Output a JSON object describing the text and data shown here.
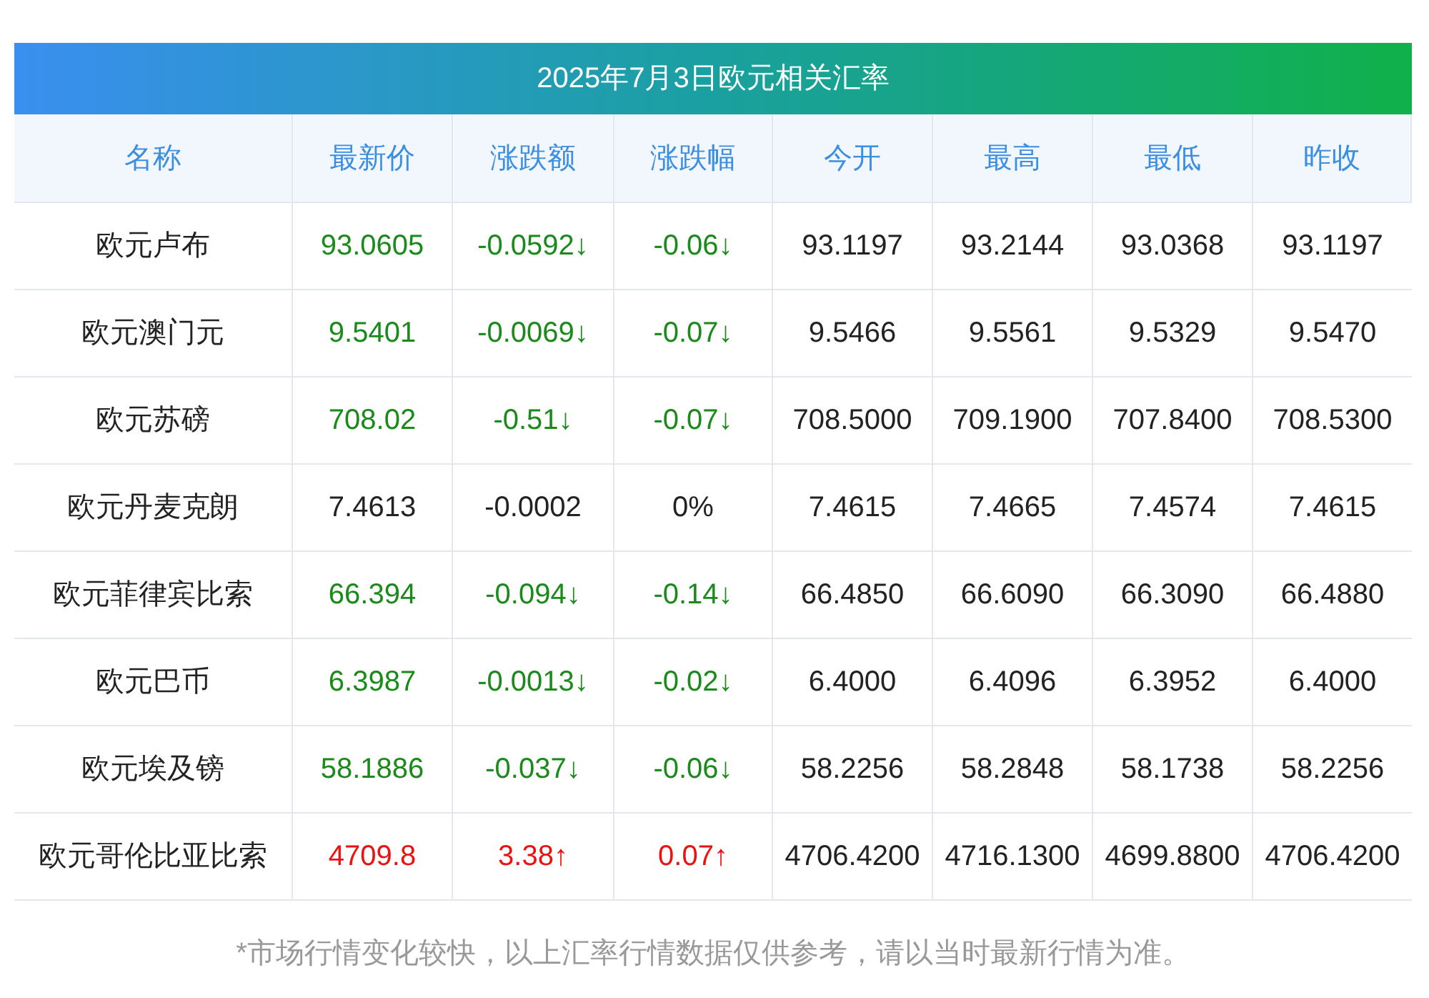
{
  "title": "2025年7月3日欧元相关汇率",
  "columns": [
    "名称",
    "最新价",
    "涨跌额",
    "涨跌幅",
    "今开",
    "最高",
    "最低",
    "昨收"
  ],
  "rows": [
    {
      "kind": "down",
      "cells": [
        "欧元卢布",
        "93.0605",
        "-0.0592↓",
        "-0.06↓",
        "93.1197",
        "93.2144",
        "93.0368",
        "93.1197"
      ]
    },
    {
      "kind": "down",
      "cells": [
        "欧元澳门元",
        "9.5401",
        "-0.0069↓",
        "-0.07↓",
        "9.5466",
        "9.5561",
        "9.5329",
        "9.5470"
      ]
    },
    {
      "kind": "down",
      "cells": [
        "欧元苏磅",
        "708.02",
        "-0.51↓",
        "-0.07↓",
        "708.5000",
        "709.1900",
        "707.8400",
        "708.5300"
      ]
    },
    {
      "kind": "flat",
      "cells": [
        "欧元丹麦克朗",
        "7.4613",
        "-0.0002",
        "0%",
        "7.4615",
        "7.4665",
        "7.4574",
        "7.4615"
      ]
    },
    {
      "kind": "down",
      "cells": [
        "欧元菲律宾比索",
        "66.394",
        "-0.094↓",
        "-0.14↓",
        "66.4850",
        "66.6090",
        "66.3090",
        "66.4880"
      ]
    },
    {
      "kind": "down",
      "cells": [
        "欧元巴币",
        "6.3987",
        "-0.0013↓",
        "-0.02↓",
        "6.4000",
        "6.4096",
        "6.3952",
        "6.4000"
      ]
    },
    {
      "kind": "down",
      "cells": [
        "欧元埃及镑",
        "58.1886",
        "-0.037↓",
        "-0.06↓",
        "58.2256",
        "58.2848",
        "58.1738",
        "58.2256"
      ]
    },
    {
      "kind": "up",
      "cells": [
        "欧元哥伦比亚比索",
        "4709.8",
        "3.38↑",
        "0.07↑",
        "4706.4200",
        "4716.1300",
        "4699.8800",
        "4706.4200"
      ]
    }
  ],
  "footnote": "*市场行情变化较快，以上汇率行情数据仅供参考，请以当时最新行情为准。"
}
